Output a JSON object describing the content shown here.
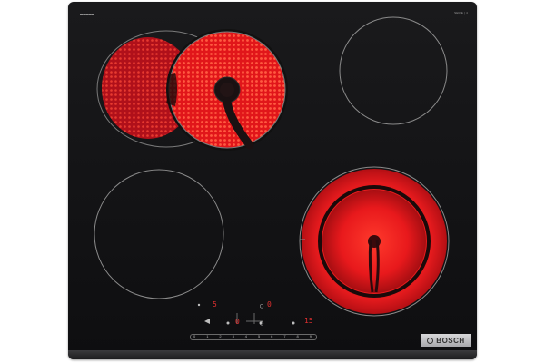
{
  "product": {
    "brand": "BOSCH",
    "serie_badge": "SERIE | 4"
  },
  "controls": {
    "row1_left": "5",
    "row1_right": "0",
    "row2_left": "0",
    "row2_right": "15",
    "slider_labels": [
      "0",
      "1",
      "2",
      "3",
      "4",
      "5",
      "6",
      "7",
      "8",
      "9"
    ]
  },
  "colors": {
    "glass": "#121214",
    "zone_active": "#e8191c",
    "zone_outline": "#8a8a8a",
    "display": "#e23030"
  },
  "zones": [
    {
      "name": "rear-left",
      "state": "on",
      "type": "extended-oval"
    },
    {
      "name": "rear-right",
      "state": "off"
    },
    {
      "name": "front-left",
      "state": "off"
    },
    {
      "name": "front-right",
      "state": "on",
      "type": "dual-circuit"
    }
  ]
}
